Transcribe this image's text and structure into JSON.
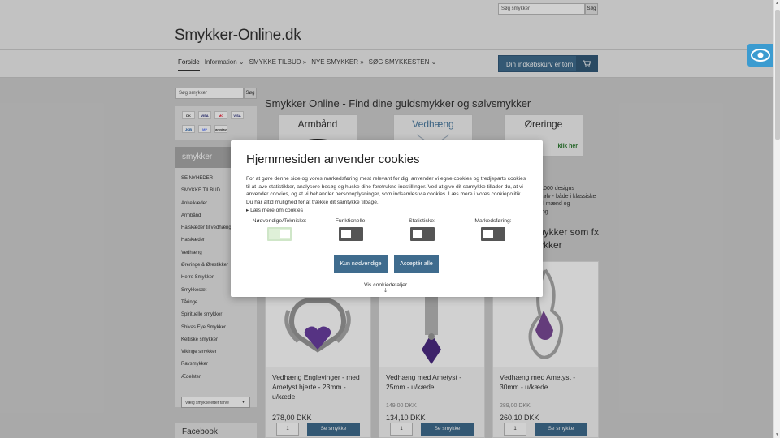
{
  "header": {
    "search_placeholder": "Søg smykker",
    "search_button": "Søg",
    "logo": "Smykker-Online.dk",
    "nav": [
      "Forside",
      "Information ⌄",
      "SMYKKE TILBUD »",
      "NYE SMYKKER »",
      "SØG SMYKKESTEN ⌄"
    ],
    "cart_label": "Din indkøbskurv er tom",
    "cart_icon": "cart-icon"
  },
  "sidebar": {
    "search_placeholder": "Søg smykker",
    "search_button": "Søg",
    "payment_icons": [
      "DK",
      "VISA",
      "MC",
      "VISA",
      "JCB",
      "MP",
      "anyday"
    ],
    "heading": "smykker",
    "items": [
      "SE NYHEDER",
      "SMYKKE TILBUD",
      "Ankelkæder",
      "Armbånd",
      "Halskæder til vedhæng",
      "Halskæder",
      "Vedhæng",
      "Øreringe & Ørestikker",
      "Herre Smykker",
      "Smykkesæt",
      "Tåringe",
      "Spirituelle smykker",
      "Shivas Eye Smykker",
      "Keltiske smykker",
      "Vikinge smykker",
      "Ravsmykker",
      "Ædelsten"
    ],
    "color_select": "Vælg smykke efter farve",
    "facebook_heading": "Facebook"
  },
  "main": {
    "title": "Smykker Online - Find dine guldsmykker og sølvsmykker",
    "categories": [
      {
        "label": "Armbånd",
        "hint": ""
      },
      {
        "label": "Vedhæng",
        "hint": ""
      },
      {
        "label": "Øreringe",
        "hint": "klik her"
      }
    ],
    "intro_text": "r 1000 designs\nf sølv - både i klassiske\nt til mænd og\nn og",
    "section_title": "nykker som fx\nykker",
    "products": [
      {
        "name": "Vedhæng Englevinger - med Ametyst hjerte - 23mm - u/kæde",
        "old_price": "",
        "price": "278,00 DKK",
        "qty": "1",
        "button": "Se smykke"
      },
      {
        "name": "Vedhæng med Ametyst - 25mm - u/kæde",
        "old_price": "149,00 DKK",
        "price": "134,10 DKK",
        "qty": "1",
        "button": "Se smykke"
      },
      {
        "name": "Vedhæng med Ametyst - 30mm - u/kæde",
        "old_price": "289,00 DKK",
        "price": "260,10 DKK",
        "qty": "1",
        "button": "Se smykke"
      }
    ]
  },
  "cookie": {
    "title": "Hjemmesiden anvender cookies",
    "text": "For at gøre denne side og vores markedsføring mest relevant for dig, anvender vi egne cookies og tredjeparts cookies til at lave statistikker, analysere besøg og huske dine foretrukne indstillinger. Ved at give dit samtykke tillader du, at vi anvender cookies, og at vi behandler personoplysninger, som indsamles via cookies. Læs mere i vores cookiepolitik. Du har altid mulighed for at trække dit samtykke tilbage.",
    "read_more": "Læs mere om cookies",
    "toggles": [
      {
        "label": "Nødvendige/Tekniske:",
        "state": "on"
      },
      {
        "label": "Funktionelle:",
        "state": "off"
      },
      {
        "label": "Statistiske:",
        "state": "off"
      },
      {
        "label": "Markedsføring:",
        "state": "off"
      }
    ],
    "btn_necessary": "Kun nødvendige",
    "btn_accept": "Acceptér alle",
    "details": "Vis cookiedetaljer"
  },
  "colors": {
    "accent": "#3f6c8e",
    "accessibility": "#3b9bd0"
  }
}
